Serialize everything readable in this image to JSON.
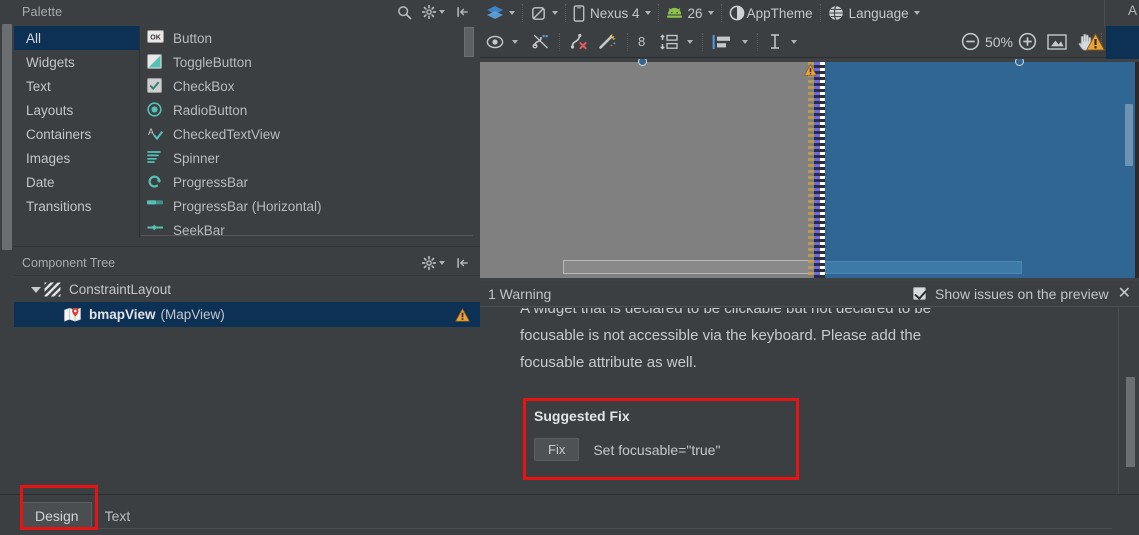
{
  "palette": {
    "title": "Palette",
    "header_icons": [
      "search-icon",
      "gear-icon",
      "collapse-icon"
    ],
    "categories": [
      {
        "label": "All",
        "selected": true
      },
      {
        "label": "Widgets",
        "selected": false
      },
      {
        "label": "Text",
        "selected": false
      },
      {
        "label": "Layouts",
        "selected": false
      },
      {
        "label": "Containers",
        "selected": false
      },
      {
        "label": "Images",
        "selected": false
      },
      {
        "label": "Date",
        "selected": false
      },
      {
        "label": "Transitions",
        "selected": false
      }
    ],
    "items": [
      {
        "label": "Button",
        "icon": "ok-button-icon"
      },
      {
        "label": "ToggleButton",
        "icon": "toggle-button-icon"
      },
      {
        "label": "CheckBox",
        "icon": "checkbox-icon"
      },
      {
        "label": "RadioButton",
        "icon": "radiobutton-icon"
      },
      {
        "label": "CheckedTextView",
        "icon": "checked-textview-icon"
      },
      {
        "label": "Spinner",
        "icon": "spinner-icon"
      },
      {
        "label": "ProgressBar",
        "icon": "progressbar-icon"
      },
      {
        "label": "ProgressBar (Horizontal)",
        "icon": "progressbar-horizontal-icon"
      },
      {
        "label": "SeekBar",
        "icon": "seekbar-icon"
      }
    ]
  },
  "component_tree": {
    "title": "Component Tree",
    "header_icons": [
      "gear-icon",
      "collapse-icon"
    ],
    "nodes": [
      {
        "label": "ConstraintLayout",
        "type": "",
        "icon": "constraintlayout-icon",
        "selected": false,
        "expanded": true,
        "warning": false
      },
      {
        "label": "bmapView",
        "type": "(MapView)",
        "icon": "mapview-icon",
        "selected": true,
        "expanded": false,
        "warning": true
      }
    ]
  },
  "toolbar_top": {
    "design_mode_label": "",
    "orientation_label": "",
    "device": "Nexus 4",
    "api_level": "26",
    "theme": "AppTheme",
    "language": "Language",
    "far_right_letter": "A"
  },
  "toolbar_second": {
    "eye_icon": "eye-icon",
    "constraints_icon": "hide-constraints-icon",
    "clear_constraints_icon": "clear-constraints-icon",
    "infer_constraints_icon": "infer-constraints-icon",
    "default_margin": "8",
    "pack_icon": "pack-icon",
    "align_icon": "align-icon",
    "guideline_icon": "guideline-icon",
    "zoom_out_icon": "zoom-out-icon",
    "zoom_level": "50%",
    "zoom_in_icon": "zoom-in-icon",
    "zoom_fit_icon": "zoom-to-fit-icon",
    "pan_icon": "pan-hand-icon",
    "warning_icon": "warning-icon"
  },
  "issue_panel": {
    "count_label": "1 Warning",
    "show_issues_label": "Show issues on the preview",
    "show_issues_checked": true,
    "close_label": "✕",
    "message_line1": "A widget that is declared to be clickable but not declared to be",
    "message_line2": "focusable is not accessible via the keyboard. Please add the",
    "message_line3": "focusable attribute as well.",
    "suggested_fix_title": "Suggested Fix",
    "fix_button_label": "Fix",
    "fix_description": "Set focusable=\"true\""
  },
  "bottom_tabs": [
    {
      "label": "Design",
      "active": true
    },
    {
      "label": "Text",
      "active": false
    }
  ],
  "colors": {
    "background": "#3c3f41",
    "selection": "#0d3055",
    "accent_teal": "#55c1b6",
    "warning": "#e8a33d",
    "highlight_red": "#e81313",
    "blueprint_blue": "#2f6694",
    "design_gray": "#808080"
  }
}
